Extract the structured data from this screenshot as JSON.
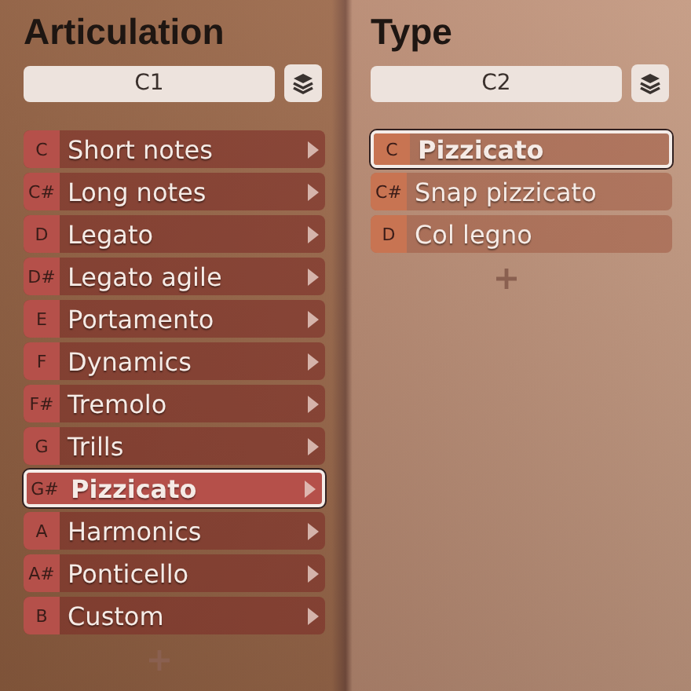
{
  "columns": [
    {
      "title": "Articulation",
      "field": "C1",
      "color": "#b5504a",
      "items": [
        {
          "key": "C",
          "label": "Short notes",
          "submenu": true,
          "selected": false
        },
        {
          "key": "C#",
          "label": "Long notes",
          "submenu": true,
          "selected": false
        },
        {
          "key": "D",
          "label": "Legato",
          "submenu": true,
          "selected": false
        },
        {
          "key": "D#",
          "label": "Legato agile",
          "submenu": true,
          "selected": false
        },
        {
          "key": "E",
          "label": "Portamento",
          "submenu": true,
          "selected": false
        },
        {
          "key": "F",
          "label": "Dynamics",
          "submenu": true,
          "selected": false
        },
        {
          "key": "F#",
          "label": "Tremolo",
          "submenu": true,
          "selected": false
        },
        {
          "key": "G",
          "label": "Trills",
          "submenu": true,
          "selected": false
        },
        {
          "key": "G#",
          "label": "Pizzicato",
          "submenu": true,
          "selected": true
        },
        {
          "key": "A",
          "label": "Harmonics",
          "submenu": true,
          "selected": false
        },
        {
          "key": "A#",
          "label": "Ponticello",
          "submenu": true,
          "selected": false
        },
        {
          "key": "B",
          "label": "Custom",
          "submenu": true,
          "selected": false
        }
      ]
    },
    {
      "title": "Type",
      "field": "C2",
      "color": "#c87452",
      "items": [
        {
          "key": "C",
          "label": "Pizzicato",
          "submenu": false,
          "selected": true
        },
        {
          "key": "C#",
          "label": "Snap pizzicato",
          "submenu": false,
          "selected": false
        },
        {
          "key": "D",
          "label": "Col legno",
          "submenu": false,
          "selected": false
        }
      ]
    }
  ]
}
